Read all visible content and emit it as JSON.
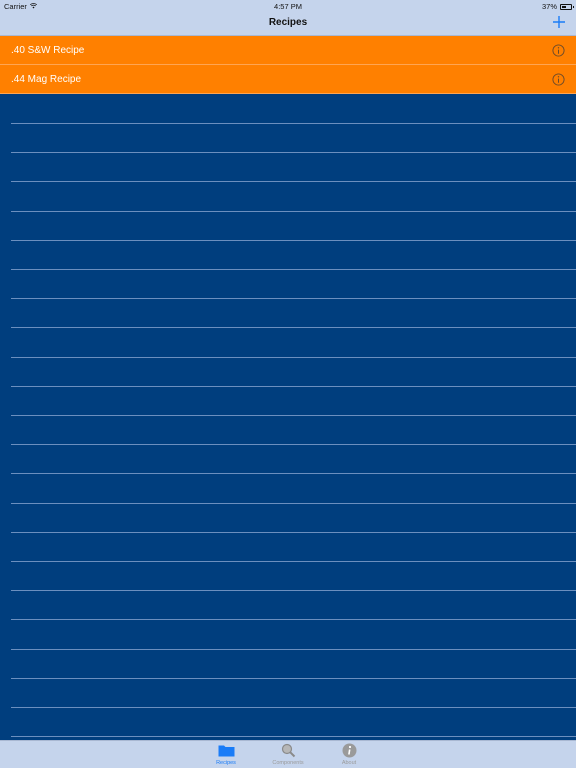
{
  "status_bar": {
    "carrier": "Carrier",
    "time": "4:57 PM",
    "battery": "37%"
  },
  "nav": {
    "title": "Recipes",
    "add_icon": "plus-icon"
  },
  "recipes": [
    {
      "label": ".40 S&W Recipe",
      "icon": "info-icon"
    },
    {
      "label": ".44 Mag Recipe",
      "icon": "info-icon"
    }
  ],
  "tabs": [
    {
      "label": "Recipes",
      "icon": "folder-icon",
      "active": true
    },
    {
      "label": "Components",
      "icon": "magnifier-icon",
      "active": false
    },
    {
      "label": "About",
      "icon": "info-icon",
      "active": false
    }
  ],
  "colors": {
    "row": "#ff8000",
    "background": "#003e7e",
    "bars": "#c5d4ec",
    "accent": "#1a7cf7"
  }
}
